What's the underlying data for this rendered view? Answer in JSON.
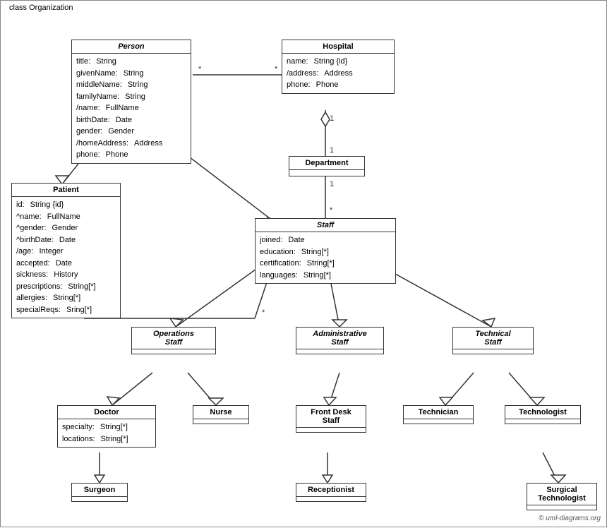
{
  "diagram_title": "class Organization",
  "copyright": "© uml-diagrams.org",
  "classes": {
    "person": {
      "name": "Person",
      "italic": true,
      "attributes": [
        {
          "name": "title:",
          "type": "String"
        },
        {
          "name": "givenName:",
          "type": "String"
        },
        {
          "name": "middleName:",
          "type": "String"
        },
        {
          "name": "familyName:",
          "type": "String"
        },
        {
          "name": "/name:",
          "type": "FullName"
        },
        {
          "name": "birthDate:",
          "type": "Date"
        },
        {
          "name": "gender:",
          "type": "Gender"
        },
        {
          "name": "/homeAddress:",
          "type": "Address"
        },
        {
          "name": "phone:",
          "type": "Phone"
        }
      ]
    },
    "hospital": {
      "name": "Hospital",
      "italic": false,
      "attributes": [
        {
          "name": "name:",
          "type": "String {id}"
        },
        {
          "name": "/address:",
          "type": "Address"
        },
        {
          "name": "phone:",
          "type": "Phone"
        }
      ]
    },
    "patient": {
      "name": "Patient",
      "italic": false,
      "attributes": [
        {
          "name": "id:",
          "type": "String {id}"
        },
        {
          "name": "^name:",
          "type": "FullName"
        },
        {
          "name": "^gender:",
          "type": "Gender"
        },
        {
          "name": "^birthDate:",
          "type": "Date"
        },
        {
          "name": "/age:",
          "type": "Integer"
        },
        {
          "name": "accepted:",
          "type": "Date"
        },
        {
          "name": "sickness:",
          "type": "History"
        },
        {
          "name": "prescriptions:",
          "type": "String[*]"
        },
        {
          "name": "allergies:",
          "type": "String[*]"
        },
        {
          "name": "specialReqs:",
          "type": "Sring[*]"
        }
      ]
    },
    "department": {
      "name": "Department",
      "italic": false,
      "attributes": []
    },
    "staff": {
      "name": "Staff",
      "italic": true,
      "attributes": [
        {
          "name": "joined:",
          "type": "Date"
        },
        {
          "name": "education:",
          "type": "String[*]"
        },
        {
          "name": "certification:",
          "type": "String[*]"
        },
        {
          "name": "languages:",
          "type": "String[*]"
        }
      ]
    },
    "operations_staff": {
      "name": "Operations\nStaff",
      "italic": true,
      "attributes": []
    },
    "administrative_staff": {
      "name": "Administrative\nStaff",
      "italic": true,
      "attributes": []
    },
    "technical_staff": {
      "name": "Technical\nStaff",
      "italic": true,
      "attributes": []
    },
    "doctor": {
      "name": "Doctor",
      "italic": false,
      "attributes": [
        {
          "name": "specialty:",
          "type": "String[*]"
        },
        {
          "name": "locations:",
          "type": "String[*]"
        }
      ]
    },
    "nurse": {
      "name": "Nurse",
      "italic": false,
      "attributes": []
    },
    "front_desk_staff": {
      "name": "Front Desk\nStaff",
      "italic": false,
      "attributes": []
    },
    "technician": {
      "name": "Technician",
      "italic": false,
      "attributes": []
    },
    "technologist": {
      "name": "Technologist",
      "italic": false,
      "attributes": []
    },
    "surgeon": {
      "name": "Surgeon",
      "italic": false,
      "attributes": []
    },
    "receptionist": {
      "name": "Receptionist",
      "italic": false,
      "attributes": []
    },
    "surgical_technologist": {
      "name": "Surgical\nTechnologist",
      "italic": false,
      "attributes": []
    }
  }
}
